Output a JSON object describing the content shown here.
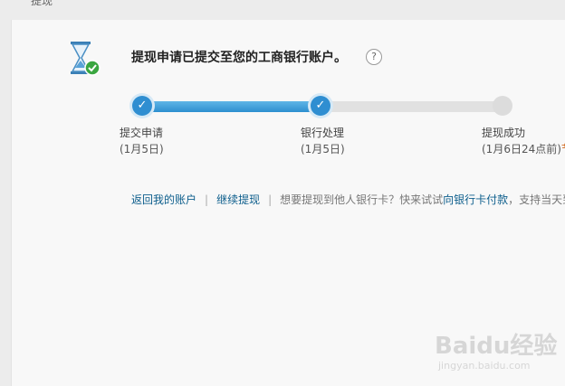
{
  "header": {
    "crumb": "提现"
  },
  "status": {
    "headline": "提现申请已提交至您的工商银行账户。",
    "help_glyph": "?"
  },
  "progress": {
    "completed_fraction": 0.5,
    "steps": [
      {
        "label": "提交申请",
        "date": "(1月5日)",
        "state": "done"
      },
      {
        "label": "银行处理",
        "date": "(1月5日)",
        "state": "done"
      },
      {
        "label": "提现成功",
        "date": "(1月6日24点前)",
        "date_more": "节",
        "state": "pending"
      }
    ]
  },
  "links": {
    "back_to_account": "返回我的账户",
    "continue_withdraw": "继续提现",
    "hint_prefix": "想要提现到他人银行卡？快来试试",
    "bank_card_payment": "向银行卡付款",
    "hint_suffix": "，支持当天到"
  },
  "watermark": {
    "brand": "Baidu经验",
    "url": "jingyan.baidu.com"
  },
  "colors": {
    "accent": "#2f8ed1",
    "link": "#0d5e8c",
    "success": "#3aa640"
  },
  "icons": {
    "status": "hourglass-check-icon",
    "help": "help-icon",
    "step_done": "check-icon"
  }
}
